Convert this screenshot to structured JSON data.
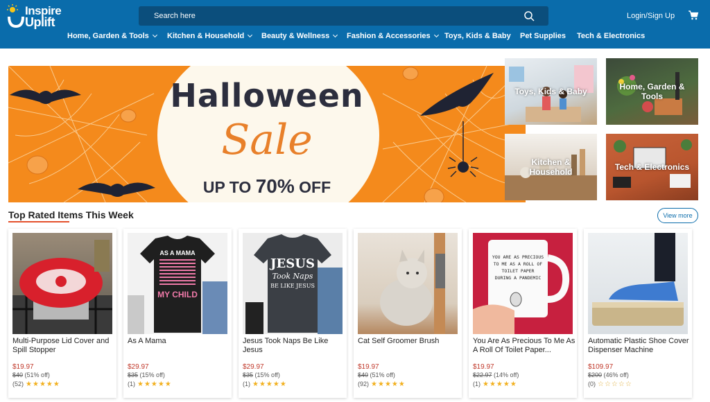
{
  "header": {
    "logo_line1": "Inspire",
    "logo_line2": "Uplift",
    "search_placeholder": "Search here",
    "login_label": "Login/Sign Up",
    "accent": "#0a6cab"
  },
  "nav": [
    {
      "label": "Home, Garden & Tools",
      "dropdown": true
    },
    {
      "label": "Kitchen & Household",
      "dropdown": true
    },
    {
      "label": "Beauty & Wellness",
      "dropdown": true
    },
    {
      "label": "Fashion & Accessories",
      "dropdown": true
    },
    {
      "label": "Toys, Kids & Baby",
      "dropdown": false
    },
    {
      "label": "Pet Supplies",
      "dropdown": false
    },
    {
      "label": "Tech & Electronics",
      "dropdown": false
    }
  ],
  "banner": {
    "title": "Halloween",
    "sale": "Sale",
    "offer_prefix": "UP TO",
    "offer_value": "70%",
    "offer_suffix": "OFF"
  },
  "categories": [
    {
      "label": "Toys, Kids & Baby"
    },
    {
      "label": "Home, Garden & Tools"
    },
    {
      "label": "Kitchen & Household"
    },
    {
      "label": "Tech & Electronics"
    }
  ],
  "section": {
    "title": "Top Rated Items This Week",
    "view_more": "View more"
  },
  "products": [
    {
      "name": "Multi-Purpose Lid Cover and Spill Stopper",
      "price": "$19.97",
      "was": "$40",
      "off": "(51% off)",
      "reviews": "(52)",
      "stars": "★★★★★"
    },
    {
      "name": "As A Mama",
      "price": "$29.97",
      "was": "$35",
      "off": "(15% off)",
      "reviews": "(1)",
      "stars": "★★★★★"
    },
    {
      "name": "Jesus Took Naps Be Like Jesus",
      "price": "$29.97",
      "was": "$35",
      "off": "(15% off)",
      "reviews": "(1)",
      "stars": "★★★★★"
    },
    {
      "name": "Cat Self Groomer Brush",
      "price": "$19.97",
      "was": "$40",
      "off": "(51% off)",
      "reviews": "(92)",
      "stars": "★★★★★"
    },
    {
      "name": "You Are As Precious To Me As A Roll Of Toilet Paper...",
      "price": "$19.97",
      "was": "$22.97",
      "off": "(14% off)",
      "reviews": "(1)",
      "stars": "★★★★★"
    },
    {
      "name": "Automatic Plastic Shoe Cover Dispenser Machine",
      "price": "$109.97",
      "was": "$200",
      "off": "(46% off)",
      "reviews": "(0)",
      "stars": "☆☆☆☆☆"
    }
  ],
  "shirt_text": {
    "mama_top": "AS A MAMA",
    "mama_bottom": "MY CHILD",
    "jesus_line1": "JESUS",
    "jesus_line2": "Took Naps",
    "jesus_line3": "BE LIKE JESUS"
  },
  "mug_text": [
    "YOU ARE AS PRECIOUS",
    "TO ME AS A ROLL OF",
    "TOILET PAPER",
    "DURING A PANDEMIC"
  ]
}
